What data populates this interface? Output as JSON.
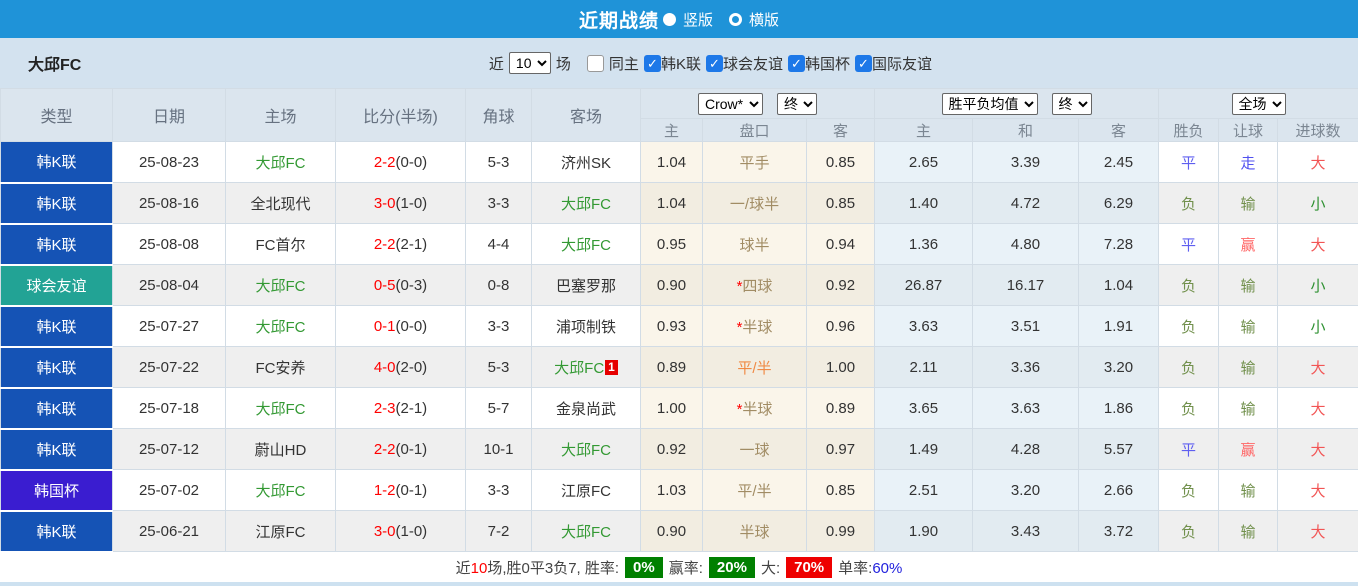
{
  "topbar": {
    "title": "近期战绩",
    "radio_vertical": "竖版",
    "radio_horizontal": "横版"
  },
  "icons": {
    "check": "✓"
  },
  "filterbar": {
    "team": "大邱FC",
    "recent_label": "近",
    "recent_value": "10",
    "matches_label": "场",
    "same_home_label": "同主",
    "leagues": [
      {
        "label": "韩K联",
        "checked": true
      },
      {
        "label": "球会友谊",
        "checked": true
      },
      {
        "label": "韩国杯",
        "checked": true
      },
      {
        "label": "国际友谊",
        "checked": true
      }
    ]
  },
  "table": {
    "main_headers": [
      "类型",
      "日期",
      "主场",
      "比分(半场)",
      "角球",
      "客场"
    ],
    "dropdowns": {
      "odds_source": "Crow*",
      "odds_time": "终",
      "avg_type": "胜平负均值",
      "avg_time": "终",
      "scope": "全场"
    },
    "sub_headers": [
      "主",
      "盘口",
      "客",
      "主",
      "和",
      "客",
      "胜负",
      "让球",
      "进球数"
    ],
    "rows": [
      {
        "type": "韩K联",
        "type_color": "#1553b5",
        "date": "25-08-23",
        "home": "大邱FC",
        "home_color": "#339933",
        "score": "2-2",
        "half": "(0-0)",
        "corner": "5-3",
        "away": "济州SK",
        "away_color": "#333333",
        "away_sup": null,
        "h_odds": "1.04",
        "handicap_star": null,
        "star_color": "#ff0000",
        "handicap": "平手",
        "handicap_color": "#a18c64",
        "a_odds": "0.85",
        "avg_h": "2.65",
        "avg_d": "3.39",
        "avg_a": "2.45",
        "wl": "平",
        "wl_color": "#5f5ff0",
        "hres": "走",
        "hres_color": "#5050f0",
        "goals": "大",
        "goals_color": "#f25555"
      },
      {
        "type": "韩K联",
        "type_color": "#1553b5",
        "date": "25-08-16",
        "home": "全北现代",
        "home_color": "#333333",
        "score": "3-0",
        "half": "(1-0)",
        "corner": "3-3",
        "away": "大邱FC",
        "away_color": "#339933",
        "away_sup": null,
        "h_odds": "1.04",
        "handicap_star": null,
        "star_color": "#ff0000",
        "handicap": "一/球半",
        "handicap_color": "#a18c64",
        "a_odds": "0.85",
        "avg_h": "1.40",
        "avg_d": "4.72",
        "avg_a": "6.29",
        "wl": "负",
        "wl_color": "#71904c",
        "hres": "输",
        "hres_color": "#71904c",
        "goals": "小",
        "goals_color": "#2f9132"
      },
      {
        "type": "韩K联",
        "type_color": "#1553b5",
        "date": "25-08-08",
        "home": "FC首尔",
        "home_color": "#333333",
        "score": "2-2",
        "half": "(2-1)",
        "corner": "4-4",
        "away": "大邱FC",
        "away_color": "#339933",
        "away_sup": null,
        "h_odds": "0.95",
        "handicap_star": null,
        "star_color": "#ff0000",
        "handicap": "球半",
        "handicap_color": "#a18c64",
        "a_odds": "0.94",
        "avg_h": "1.36",
        "avg_d": "4.80",
        "avg_a": "7.28",
        "wl": "平",
        "wl_color": "#5f5ff0",
        "hres": "赢",
        "hres_color": "#ff6666",
        "goals": "大",
        "goals_color": "#f25555"
      },
      {
        "type": "球会友谊",
        "type_color": "#22a395",
        "date": "25-08-04",
        "home": "大邱FC",
        "home_color": "#339933",
        "score": "0-5",
        "half": "(0-3)",
        "corner": "0-8",
        "away": "巴塞罗那",
        "away_color": "#333333",
        "away_sup": null,
        "h_odds": "0.90",
        "handicap_star": "*",
        "star_color": "#ff0000",
        "handicap": "四球",
        "handicap_color": "#a18c64",
        "a_odds": "0.92",
        "avg_h": "26.87",
        "avg_d": "16.17",
        "avg_a": "1.04",
        "wl": "负",
        "wl_color": "#71904c",
        "hres": "输",
        "hres_color": "#71904c",
        "goals": "小",
        "goals_color": "#2f9132"
      },
      {
        "type": "韩K联",
        "type_color": "#1553b5",
        "date": "25-07-27",
        "home": "大邱FC",
        "home_color": "#339933",
        "score": "0-1",
        "half": "(0-0)",
        "corner": "3-3",
        "away": "浦项制铁",
        "away_color": "#333333",
        "away_sup": null,
        "h_odds": "0.93",
        "handicap_star": "*",
        "star_color": "#ff0000",
        "handicap": "半球",
        "handicap_color": "#a18c64",
        "a_odds": "0.96",
        "avg_h": "3.63",
        "avg_d": "3.51",
        "avg_a": "1.91",
        "wl": "负",
        "wl_color": "#71904c",
        "hres": "输",
        "hres_color": "#71904c",
        "goals": "小",
        "goals_color": "#2f9132"
      },
      {
        "type": "韩K联",
        "type_color": "#1553b5",
        "date": "25-07-22",
        "home": "FC安养",
        "home_color": "#333333",
        "score": "4-0",
        "half": "(2-0)",
        "corner": "5-3",
        "away": "大邱FC",
        "away_color": "#339933",
        "away_sup": "1",
        "h_odds": "0.89",
        "handicap_star": null,
        "star_color": "#ff0000",
        "handicap": "平/半",
        "handicap_color": "#f08a45",
        "a_odds": "1.00",
        "avg_h": "2.11",
        "avg_d": "3.36",
        "avg_a": "3.20",
        "wl": "负",
        "wl_color": "#71904c",
        "hres": "输",
        "hres_color": "#71904c",
        "goals": "大",
        "goals_color": "#f25555"
      },
      {
        "type": "韩K联",
        "type_color": "#1553b5",
        "date": "25-07-18",
        "home": "大邱FC",
        "home_color": "#339933",
        "score": "2-3",
        "half": "(2-1)",
        "corner": "5-7",
        "away": "金泉尚武",
        "away_color": "#333333",
        "away_sup": null,
        "h_odds": "1.00",
        "handicap_star": "*",
        "star_color": "#ff0000",
        "handicap": "半球",
        "handicap_color": "#a18c64",
        "a_odds": "0.89",
        "avg_h": "3.65",
        "avg_d": "3.63",
        "avg_a": "1.86",
        "wl": "负",
        "wl_color": "#71904c",
        "hres": "输",
        "hres_color": "#71904c",
        "goals": "大",
        "goals_color": "#f25555"
      },
      {
        "type": "韩K联",
        "type_color": "#1553b5",
        "date": "25-07-12",
        "home": "蔚山HD",
        "home_color": "#333333",
        "score": "2-2",
        "half": "(0-1)",
        "corner": "10-1",
        "away": "大邱FC",
        "away_color": "#339933",
        "away_sup": null,
        "h_odds": "0.92",
        "handicap_star": null,
        "star_color": "#ff0000",
        "handicap": "一球",
        "handicap_color": "#a18c64",
        "a_odds": "0.97",
        "avg_h": "1.49",
        "avg_d": "4.28",
        "avg_a": "5.57",
        "wl": "平",
        "wl_color": "#5f5ff0",
        "hres": "赢",
        "hres_color": "#ff6666",
        "goals": "大",
        "goals_color": "#f25555"
      },
      {
        "type": "韩国杯",
        "type_color": "#3a1dd0",
        "date": "25-07-02",
        "home": "大邱FC",
        "home_color": "#339933",
        "score": "1-2",
        "half": "(0-1)",
        "corner": "3-3",
        "away": "江原FC",
        "away_color": "#333333",
        "away_sup": null,
        "h_odds": "1.03",
        "handicap_star": null,
        "star_color": "#ff0000",
        "handicap": "平/半",
        "handicap_color": "#a18c64",
        "a_odds": "0.85",
        "avg_h": "2.51",
        "avg_d": "3.20",
        "avg_a": "2.66",
        "wl": "负",
        "wl_color": "#71904c",
        "hres": "输",
        "hres_color": "#71904c",
        "goals": "大",
        "goals_color": "#f25555"
      },
      {
        "type": "韩K联",
        "type_color": "#1553b5",
        "date": "25-06-21",
        "home": "江原FC",
        "home_color": "#333333",
        "score": "3-0",
        "half": "(1-0)",
        "corner": "7-2",
        "away": "大邱FC",
        "away_color": "#339933",
        "away_sup": null,
        "h_odds": "0.90",
        "handicap_star": null,
        "star_color": "#ff0000",
        "handicap": "半球",
        "handicap_color": "#a18c64",
        "a_odds": "0.99",
        "avg_h": "1.90",
        "avg_d": "3.43",
        "avg_a": "3.72",
        "wl": "负",
        "wl_color": "#71904c",
        "hres": "输",
        "hres_color": "#71904c",
        "goals": "大",
        "goals_color": "#f25555"
      }
    ]
  },
  "summary": {
    "prefix": "近",
    "count": "10",
    "rest": "场,胜0平3负7, 胜率:",
    "win_badge": "0%",
    "win_badge_color": "#008000",
    "cover_label": "赢率:",
    "cover_badge": "20%",
    "cover_badge_color": "#008000",
    "big_label": "大:",
    "big_badge": "70%",
    "big_badge_color": "#ee0000",
    "single_label": "单率:",
    "single_value": "60%",
    "single_color": "#2222dd"
  },
  "colors": {
    "topbar_bg": "#1f93d8",
    "filterbar_bg": "#d3e2ef",
    "header_bg": "#dbe5ee",
    "team_highlight": "#339933",
    "score_red": "#ff0000"
  }
}
